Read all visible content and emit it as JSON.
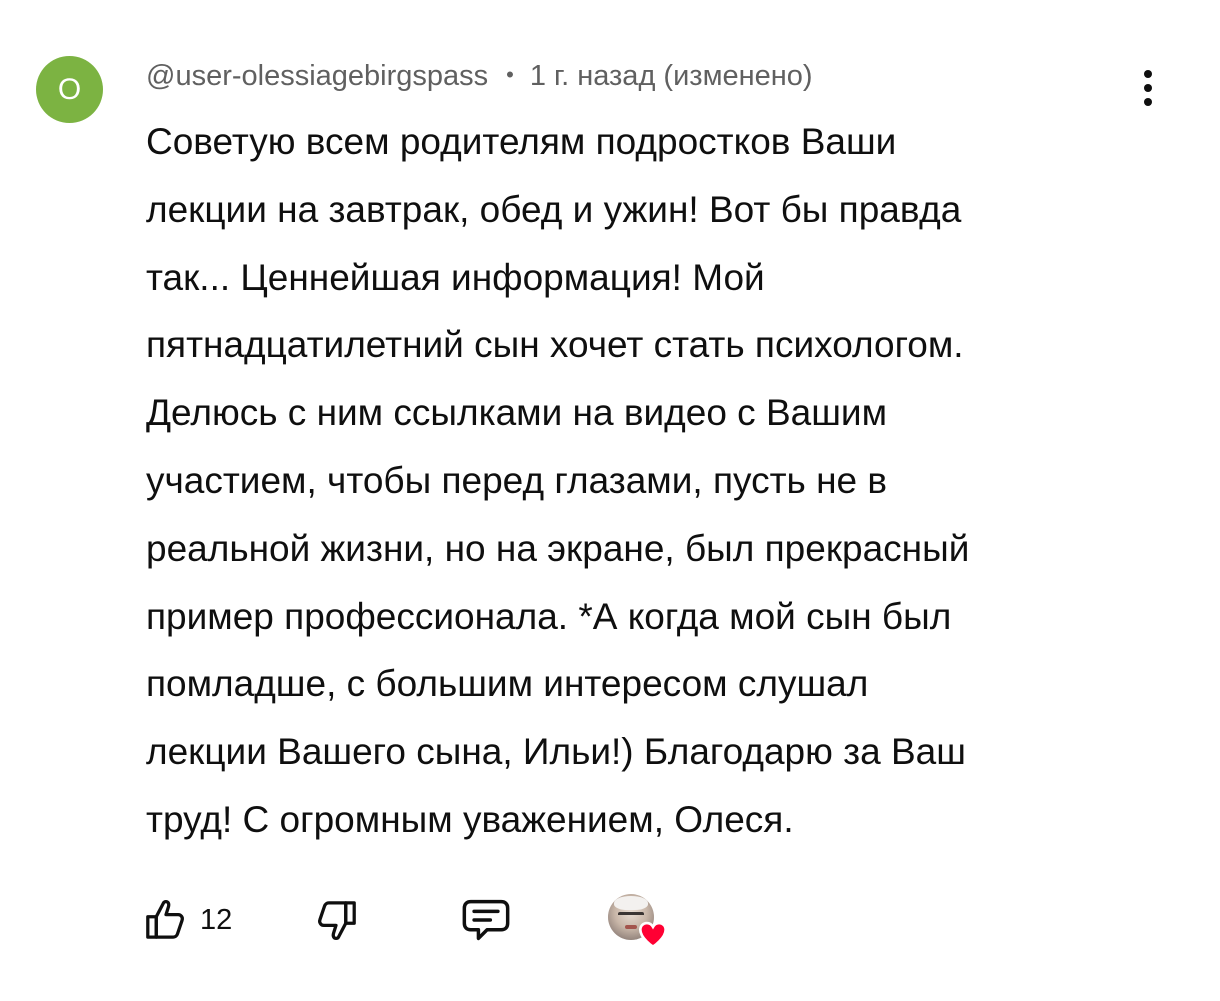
{
  "comment": {
    "avatar_letter": "О",
    "avatar_color": "#7cb342",
    "author": "@user-olessiagebirgspass",
    "separator": "•",
    "timestamp": "1 г. назад (изменено)",
    "menu_icon": "more-vert-icon",
    "text_lines": [
      "Советую всем родителям подростков Ваши",
      "лекции на завтрак, обед и ужин! Вот бы правда",
      "так... Ценнейшая информация! Мой",
      "пятнадцатилетний сын хочет стать психологом.",
      "Делюсь с ним ссылками на видео с Вашим",
      "участием, чтобы перед глазами, пусть не в",
      "реальной жизни, но на экране, был прекрасный",
      "пример профессионала. *А когда мой сын был",
      "помладше, с большим интересом слушал",
      "лекции Вашего сына, Ильи!) Благодарю за Ваш",
      "труд! С огромным уважением, Олеся."
    ]
  },
  "actions": {
    "like_icon": "thumbs-up-icon",
    "like_count": "12",
    "dislike_icon": "thumbs-down-icon",
    "reply_icon": "reply-comment-icon",
    "creator_heart_icon": "creator-heart-icon",
    "heart_color": "#ff0033"
  }
}
